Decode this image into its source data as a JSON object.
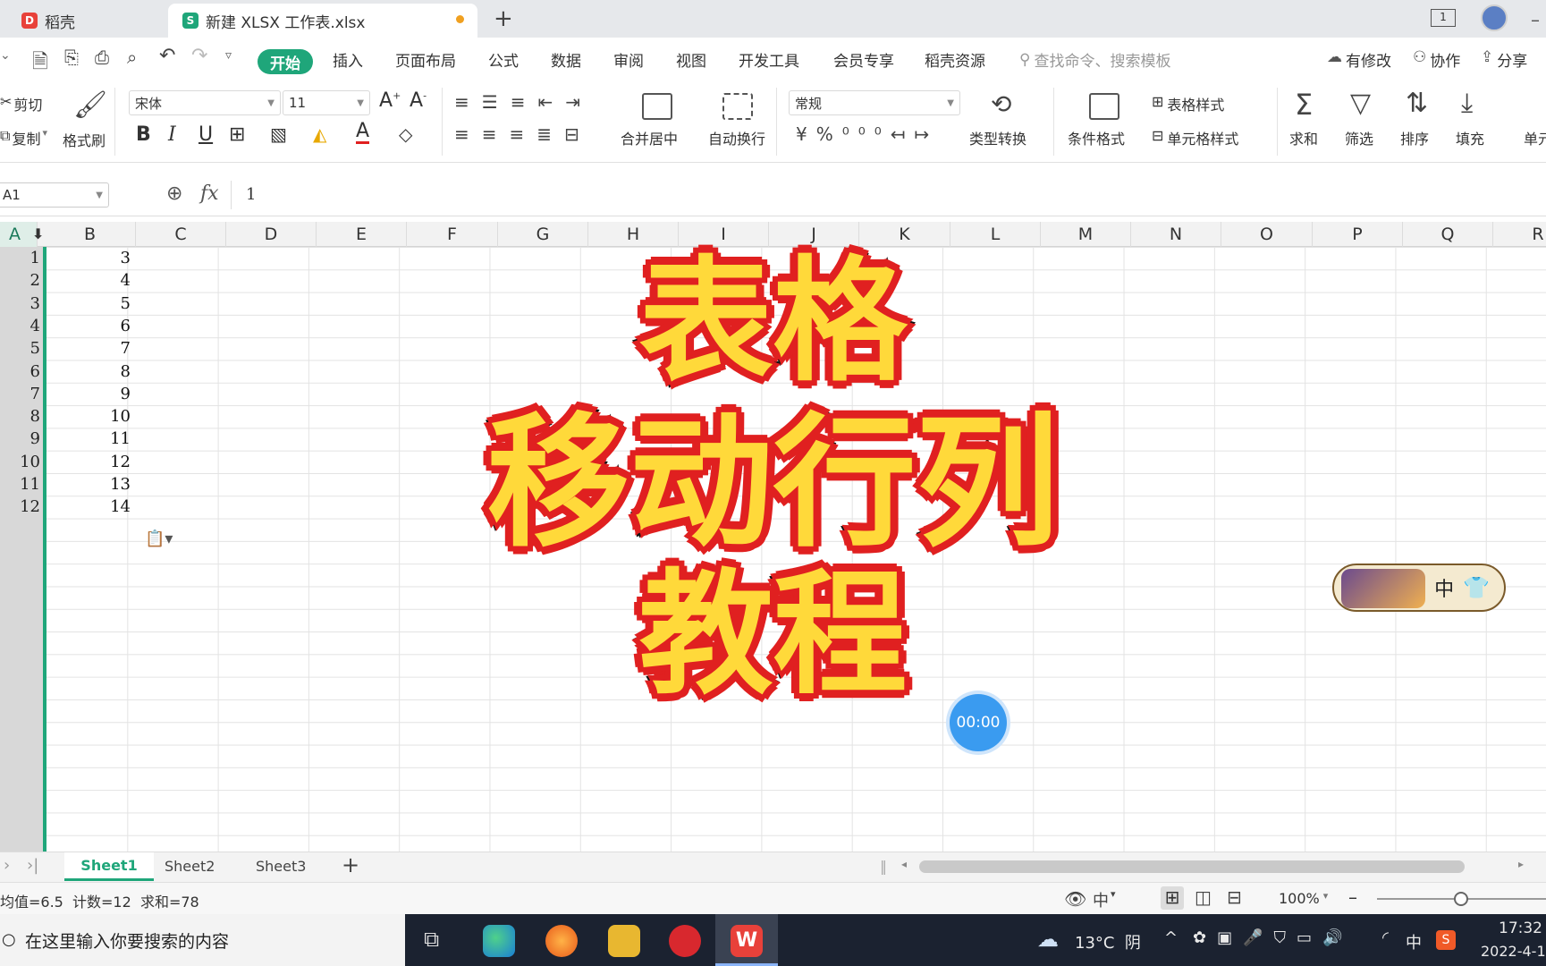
{
  "tabs": {
    "tab1": "稻壳",
    "tab2": "新建 XLSX 工作表.xlsx",
    "badge": "1"
  },
  "menu": {
    "start": "开始",
    "items": [
      "插入",
      "页面布局",
      "公式",
      "数据",
      "审阅",
      "视图",
      "开发工具",
      "会员专享",
      "稻壳资源"
    ],
    "search_placeholder": "查找命令、搜索模板",
    "has_changes": "有修改",
    "collab": "协作",
    "share": "分享"
  },
  "ribbon": {
    "cut": "剪切",
    "copy": "复制",
    "format_painter": "格式刷",
    "font_name": "宋体",
    "font_size": "11",
    "merge_center": "合并居中",
    "wrap_text": "自动换行",
    "number_format": "常规",
    "type_convert": "类型转换",
    "cond_format": "条件格式",
    "table_style": "表格样式",
    "cell_style": "单元格样式",
    "sum": "求和",
    "filter": "筛选",
    "sort": "排序",
    "fill": "填充",
    "cell_more": "单元"
  },
  "formula": {
    "cell_ref": "A1",
    "fx": "fx",
    "value": "1"
  },
  "columns": [
    "A",
    "B",
    "C",
    "D",
    "E",
    "F",
    "G",
    "H",
    "I",
    "J",
    "K",
    "L",
    "M",
    "N",
    "O",
    "P",
    "Q",
    "R"
  ],
  "rows": [
    "1",
    "2",
    "3",
    "4",
    "5",
    "6",
    "7",
    "8",
    "9",
    "10",
    "11",
    "12"
  ],
  "col_b_values": [
    "3",
    "4",
    "5",
    "6",
    "7",
    "8",
    "9",
    "10",
    "11",
    "12",
    "13",
    "14"
  ],
  "overlay": {
    "line1": "表格",
    "line2": "移动行列",
    "line3": "教程",
    "timer": "00:00",
    "ime_mode": "中"
  },
  "sheets": [
    "Sheet1",
    "Sheet2",
    "Sheet3"
  ],
  "status": {
    "summary": "均值=6.5  计数=12  求和=78",
    "zoom": "100%",
    "ime": "中"
  },
  "taskbar": {
    "search": "在这里输入你要搜索的内容",
    "weather": "13°C  阴",
    "ime": "中",
    "time": "17:32",
    "date": "2022-4-1"
  },
  "colors": {
    "accent": "#1fa67a",
    "overlay_fill": "#ffd93a",
    "overlay_outline": "#e02020",
    "timer_bg": "#3a9bf0"
  }
}
